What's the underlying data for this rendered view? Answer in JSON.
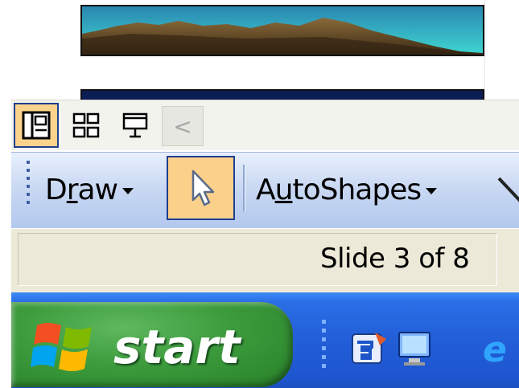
{
  "view_bar": {
    "normal_view": "normal-view-icon",
    "slide_sorter": "slide-sorter-icon",
    "slide_show": "slide-show-icon",
    "scroll_left": "<"
  },
  "drawing_toolbar": {
    "draw_label_pre": "D",
    "draw_label_mnemonic": "r",
    "draw_label_post": "aw",
    "select_tool": "select-pointer-icon",
    "autoshapes_label_pre": "A",
    "autoshapes_label_mnemonic": "u",
    "autoshapes_label_post": "toShapes"
  },
  "status_bar": {
    "slide_indicator": "Slide 3 of 8"
  },
  "taskbar": {
    "start_label": "start",
    "quick_launch": [
      "outlook-express-icon",
      "show-desktop-icon",
      "internet-explorer-icon"
    ]
  },
  "colors": {
    "taskbar_blue": "#225ed8",
    "start_green": "#3c9b3c",
    "active_button": "#fbd08b"
  }
}
